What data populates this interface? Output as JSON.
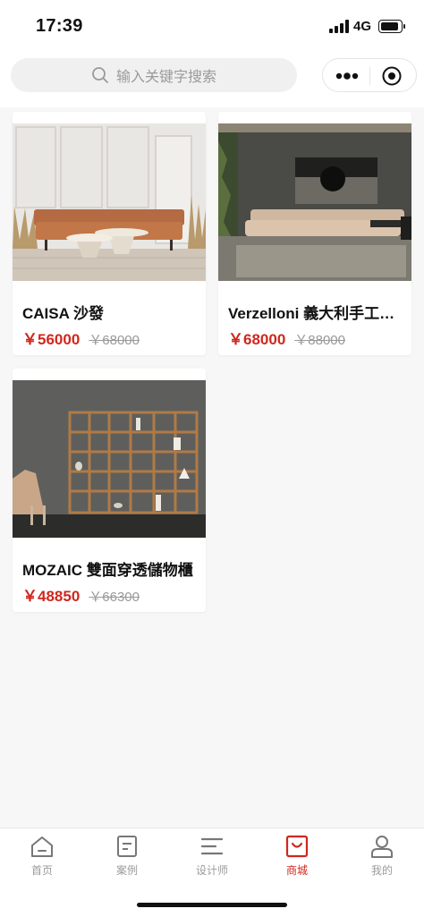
{
  "status_bar": {
    "time": "17:39",
    "network": "4G"
  },
  "search": {
    "placeholder": "输入关键字搜索"
  },
  "colors": {
    "accent": "#d0271d",
    "muted": "#9b9b9b",
    "background": "#f7f7f8"
  },
  "products": [
    {
      "name": "CAISA 沙發",
      "price": "￥56000",
      "original_price": "￥68000",
      "image": "sofa-living-room-photo"
    },
    {
      "name": "Verzelloni 義大利手工沙發",
      "price": "￥68000",
      "original_price": "￥88000",
      "image": "modular-sofa-photo"
    },
    {
      "name": "MOZAIC 雙面穿透儲物櫃",
      "price": "￥48850",
      "original_price": "￥66300",
      "image": "bookshelf-photo"
    }
  ],
  "tabs": [
    {
      "label": "首页",
      "icon": "home-icon",
      "active": false
    },
    {
      "label": "案例",
      "icon": "case-icon",
      "active": false
    },
    {
      "label": "设计师",
      "icon": "designer-icon",
      "active": false
    },
    {
      "label": "商城",
      "icon": "mall-icon",
      "active": true
    },
    {
      "label": "我的",
      "icon": "profile-icon",
      "active": false
    }
  ]
}
